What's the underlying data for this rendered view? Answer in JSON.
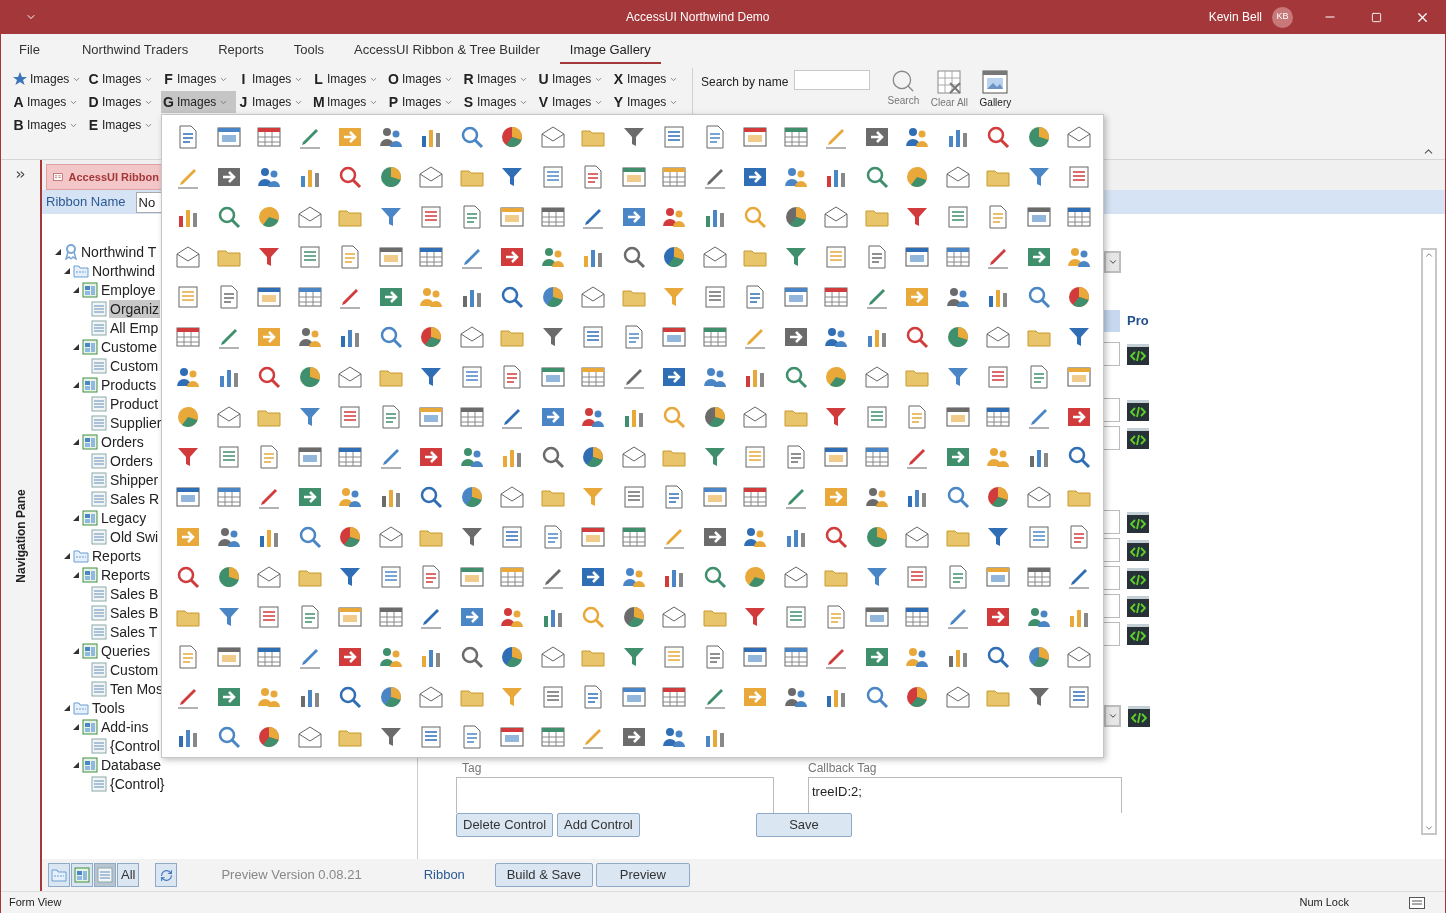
{
  "window": {
    "title": "AccessUI Northwind Demo",
    "user": "Kevin Bell",
    "avatar": "KB"
  },
  "menu_tabs": [
    {
      "label": "File",
      "selected": false
    },
    {
      "label": "Northwind Traders",
      "selected": false
    },
    {
      "label": "Reports",
      "selected": false
    },
    {
      "label": "Tools",
      "selected": false
    },
    {
      "label": "AccessUI Ribbon & Tree Builder",
      "selected": false
    },
    {
      "label": "Image Gallery",
      "selected": true
    }
  ],
  "image_button_rows": [
    [
      {
        "kind": "star",
        "label": "Images",
        "selected": false
      },
      {
        "kind": "letter",
        "letter": "C",
        "label": "Images",
        "selected": false
      },
      {
        "kind": "letter",
        "letter": "F",
        "label": "Images",
        "selected": false
      },
      {
        "kind": "letter",
        "letter": "I",
        "label": "Images",
        "selected": false
      },
      {
        "kind": "letter",
        "letter": "L",
        "label": "Images",
        "selected": false
      },
      {
        "kind": "letter",
        "letter": "O",
        "label": "Images",
        "selected": false
      },
      {
        "kind": "letter",
        "letter": "R",
        "label": "Images",
        "selected": false
      },
      {
        "kind": "letter",
        "letter": "U",
        "label": "Images",
        "selected": false
      },
      {
        "kind": "letter",
        "letter": "X",
        "label": "Images",
        "selected": false
      }
    ],
    [
      {
        "kind": "letter",
        "letter": "A",
        "label": "Images",
        "selected": false
      },
      {
        "kind": "letter",
        "letter": "D",
        "label": "Images",
        "selected": false
      },
      {
        "kind": "letter",
        "letter": "G",
        "label": "Images",
        "selected": true
      },
      {
        "kind": "letter",
        "letter": "J",
        "label": "Images",
        "selected": false
      },
      {
        "kind": "letter",
        "letter": "M",
        "label": "Images",
        "selected": false
      },
      {
        "kind": "letter",
        "letter": "P",
        "label": "Images",
        "selected": false
      },
      {
        "kind": "letter",
        "letter": "S",
        "label": "Images",
        "selected": false
      },
      {
        "kind": "letter",
        "letter": "V",
        "label": "Images",
        "selected": false
      },
      {
        "kind": "letter",
        "letter": "Y",
        "label": "Images",
        "selected": false
      }
    ],
    [
      {
        "kind": "letter",
        "letter": "B",
        "label": "Images",
        "selected": false
      },
      {
        "kind": "letter",
        "letter": "E",
        "label": "Images",
        "selected": false
      }
    ]
  ],
  "search": {
    "label": "Search by name"
  },
  "ribbon_buttons": [
    {
      "kind": "search",
      "label": "Search",
      "disabled": true
    },
    {
      "kind": "clear",
      "label": "Clear All",
      "disabled": true
    },
    {
      "kind": "gallery",
      "label": "Gallery",
      "disabled": false
    }
  ],
  "navigation_pane": {
    "title": "Navigation Pane"
  },
  "form": {
    "tab": "AccessUI Ribbon",
    "ribbon_name_label": "Ribbon Name",
    "ribbon_name_value": "No",
    "tree": [
      {
        "label": "Northwind T",
        "kind": "root",
        "selected": false,
        "expanded": true,
        "children": [
          {
            "label": "Northwind",
            "kind": "tab",
            "selected": false,
            "expanded": true,
            "children": [
              {
                "label": "Employe",
                "kind": "group",
                "selected": false,
                "expanded": true,
                "children": [
                  {
                    "label": "Organiz",
                    "kind": "control",
                    "selected": true
                  },
                  {
                    "label": "All Emp",
                    "kind": "control",
                    "selected": false
                  }
                ]
              },
              {
                "label": "Custome",
                "kind": "group",
                "selected": false,
                "expanded": true,
                "children": [
                  {
                    "label": "Custom",
                    "kind": "control",
                    "selected": false
                  }
                ]
              },
              {
                "label": "Products",
                "kind": "group",
                "selected": false,
                "expanded": true,
                "children": [
                  {
                    "label": "Product",
                    "kind": "control",
                    "selected": false
                  },
                  {
                    "label": "Supplier",
                    "kind": "control",
                    "selected": false
                  }
                ]
              },
              {
                "label": "Orders",
                "kind": "group",
                "selected": false,
                "expanded": true,
                "children": [
                  {
                    "label": "Orders",
                    "kind": "control",
                    "selected": false
                  },
                  {
                    "label": "Shipper",
                    "kind": "control",
                    "selected": false
                  },
                  {
                    "label": "Sales R",
                    "kind": "control",
                    "selected": false
                  }
                ]
              },
              {
                "label": "Legacy",
                "kind": "group",
                "selected": false,
                "expanded": true,
                "children": [
                  {
                    "label": "Old Swi",
                    "kind": "control",
                    "selected": false
                  }
                ]
              }
            ]
          },
          {
            "label": "Reports",
            "kind": "tab",
            "selected": false,
            "expanded": true,
            "children": [
              {
                "label": "Reports",
                "kind": "group",
                "selected": false,
                "expanded": true,
                "children": [
                  {
                    "label": "Sales B",
                    "kind": "control",
                    "selected": false
                  },
                  {
                    "label": "Sales B",
                    "kind": "control",
                    "selected": false
                  },
                  {
                    "label": "Sales T",
                    "kind": "control",
                    "selected": false
                  }
                ]
              },
              {
                "label": "Queries",
                "kind": "group",
                "selected": false,
                "expanded": true,
                "children": [
                  {
                    "label": "Custom",
                    "kind": "control",
                    "selected": false
                  },
                  {
                    "label": "Ten Mos",
                    "kind": "control",
                    "selected": false
                  }
                ]
              }
            ]
          },
          {
            "label": "Tools",
            "kind": "tab",
            "selected": false,
            "expanded": true,
            "children": [
              {
                "label": "Add-ins",
                "kind": "group",
                "selected": false,
                "expanded": true,
                "children": [
                  {
                    "label": "{Control",
                    "kind": "control",
                    "selected": false
                  }
                ]
              },
              {
                "label": "Database",
                "kind": "group",
                "selected": false,
                "expanded": true,
                "children": [
                  {
                    "label": "{Control}",
                    "kind": "control",
                    "selected": false
                  }
                ]
              }
            ]
          }
        ]
      }
    ],
    "column_header": "Pro",
    "tag_label": "Tag",
    "callback_tag_label": "Callback Tag",
    "callback_tag_value": "treeID:2;",
    "buttons": [
      "Delete Control",
      "Add Control"
    ],
    "save_button": "Save"
  },
  "footer": {
    "view_filters": [
      {
        "kind": "tab",
        "selected": false
      },
      {
        "kind": "group",
        "selected": false
      },
      {
        "kind": "control",
        "selected": true
      },
      {
        "kind": "all",
        "label": "All",
        "selected": false
      }
    ],
    "version": "Preview Version 0.08.21",
    "ribbon_link": "Ribbon",
    "buttons": [
      "Build & Save",
      "Preview"
    ]
  },
  "status_bar": {
    "left": "Form View",
    "right": "Num Lock"
  }
}
